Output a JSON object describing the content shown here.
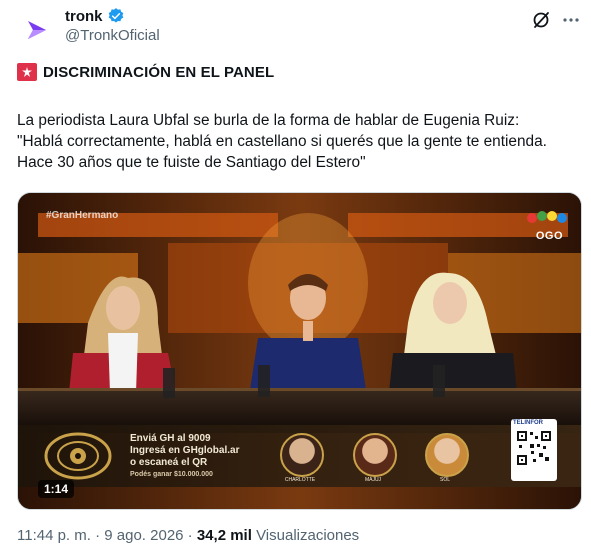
{
  "account": {
    "name": "tronk",
    "handle": "@TronkOficial",
    "avatar_icon": "tronk-logo-icon",
    "verified_icon": "verified-badge-icon",
    "brand_color": "#7a3cf0"
  },
  "actions": {
    "grok_icon": "grok-icon",
    "more_icon": "more-options-icon"
  },
  "post": {
    "headline": "DISCRIMINACIÓN EN EL PANEL",
    "headline_icon": "siren-icon",
    "body_line1": "La periodista Laura Ubfal se burla de la forma de hablar de Eugenia Ruiz:",
    "body_line2": "\"Hablá correctamente, hablá en castellano si querés que la gente te entienda. Hace 30 años que te fuiste de Santiago del Estero\""
  },
  "video": {
    "hashtag": "#GranHermano",
    "channel": "OGO",
    "banner_line1": "Enviá GH al 9009",
    "banner_line2": "Ingresá en GHglobal.ar",
    "banner_line3": "o escaneá el QR",
    "banner_line4": "Podés ganar $10.000.000",
    "contestants": [
      "CHARLOTTE",
      "MAJUJ",
      "SOL"
    ],
    "sponsor": "TELINFOR",
    "duration": "1:14"
  },
  "meta": {
    "timestamp": "11:44 p. m. · 9 ago. 2026 ·",
    "views_count": "34,2 mil",
    "views_label": "Visualizaciones"
  }
}
